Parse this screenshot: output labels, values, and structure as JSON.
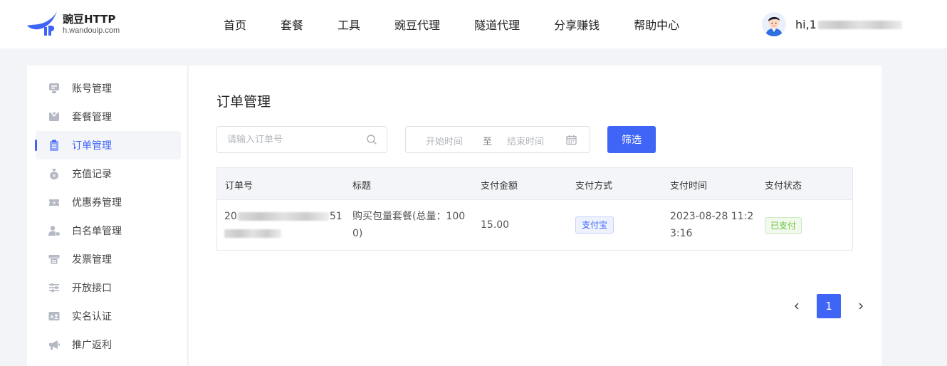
{
  "brand": {
    "name": "豌豆HTTP",
    "domain": "h.wandouip.com",
    "logo_icon": "pea-pod-logo",
    "color": "#3f65f6"
  },
  "nav": [
    {
      "label": "首页"
    },
    {
      "label": "套餐"
    },
    {
      "label": "工具"
    },
    {
      "label": "豌豆代理"
    },
    {
      "label": "隧道代理"
    },
    {
      "label": "分享赚钱"
    },
    {
      "label": "帮助中心"
    }
  ],
  "user": {
    "greeting": "hi,1",
    "avatar_icon": "user-avatar"
  },
  "sidebar": {
    "items": [
      {
        "label": "账号管理",
        "icon": "account-icon",
        "active": false
      },
      {
        "label": "套餐管理",
        "icon": "package-icon",
        "active": false
      },
      {
        "label": "订单管理",
        "icon": "order-icon",
        "active": true
      },
      {
        "label": "充值记录",
        "icon": "money-bag-icon",
        "active": false
      },
      {
        "label": "优惠券管理",
        "icon": "coupon-icon",
        "active": false
      },
      {
        "label": "白名单管理",
        "icon": "whitelist-user-icon",
        "active": false
      },
      {
        "label": "发票管理",
        "icon": "invoice-icon",
        "active": false
      },
      {
        "label": "开放接口",
        "icon": "api-sliders-icon",
        "active": false
      },
      {
        "label": "实名认证",
        "icon": "id-card-icon",
        "active": false
      },
      {
        "label": "推广返利",
        "icon": "megaphone-icon",
        "active": false
      }
    ]
  },
  "main": {
    "title": "订单管理",
    "search": {
      "placeholder": "请输入订单号",
      "value": ""
    },
    "date_range": {
      "start_placeholder": "开始时间",
      "separator": "至",
      "end_placeholder": "结束时间"
    },
    "filter_label": "筛选",
    "table": {
      "headers": [
        "订单号",
        "标题",
        "支付金额",
        "支付方式",
        "支付时间",
        "支付状态"
      ],
      "rows": [
        {
          "order_no_start": "20",
          "order_no_end": "51",
          "title_line1": "购买包量套餐(总量：100",
          "title_line2": "0)",
          "amount": "15.00",
          "method": "支付宝",
          "time_line1": "2023-08-28 11:2",
          "time_line2": "3:16",
          "status": "已支付"
        }
      ]
    },
    "pagination": {
      "current": "1"
    }
  },
  "colors": {
    "accent": "#3f65f6",
    "paid_green": "#67c23a",
    "page_bg": "#f3f4f7"
  }
}
